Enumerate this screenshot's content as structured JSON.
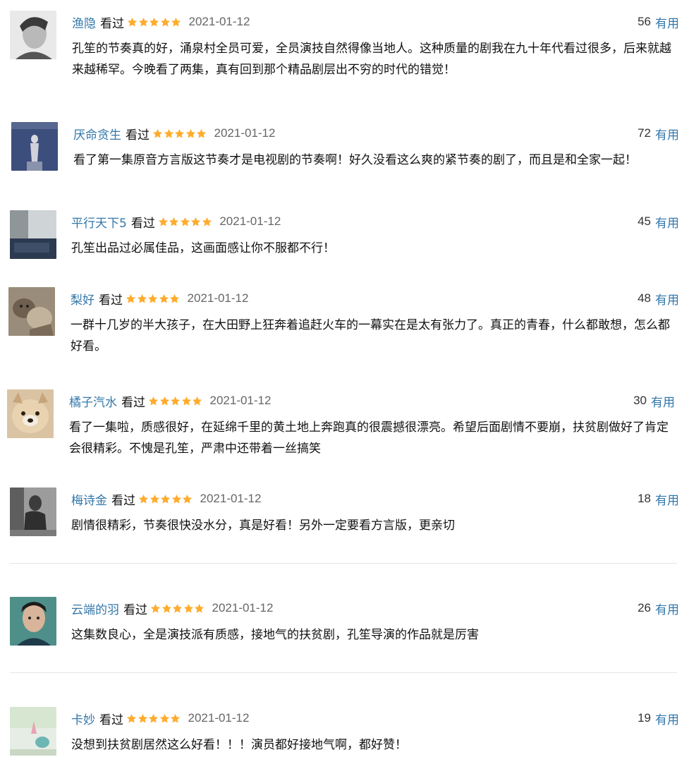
{
  "ui": {
    "watched_label": "看过",
    "vote_label": "有用"
  },
  "reviews": [
    {
      "user": "渔隐",
      "date": "2021-01-12",
      "votes": "56",
      "content": "孔笙的节奏真的好，涌泉村全员可爱，全员演技自然得像当地人。这种质量的剧我在九十年代看过很多，后来就越来越稀罕。今晚看了两集，真有回到那个精品剧层出不穷的时代的错觉！"
    },
    {
      "user": "厌命贪生",
      "date": "2021-01-12",
      "votes": "72",
      "content": "看了第一集原音方言版这节奏才是电视剧的节奏啊！好久没看这么爽的紧节奏的剧了，而且是和全家一起！"
    },
    {
      "user": "平行天下5",
      "date": "2021-01-12",
      "votes": "45",
      "content": "孔笙出品过必属佳品，这画面感让你不服都不行！"
    },
    {
      "user": "梨好",
      "date": "2021-01-12",
      "votes": "48",
      "content": "一群十几岁的半大孩子，在大田野上狂奔着追赶火车的一幕实在是太有张力了。真正的青春，什么都敢想，怎么都好看。"
    },
    {
      "user": "橘子汽水",
      "date": "2021-01-12",
      "votes": "30",
      "content": "看了一集啦，质感很好，在延绵千里的黄土地上奔跑真的很震撼很漂亮。希望后面剧情不要崩，扶贫剧做好了肯定会很精彩。不愧是孔笙，严肃中还带着一丝搞笑"
    },
    {
      "user": "梅诗金",
      "date": "2021-01-12",
      "votes": "18",
      "content": "剧情很精彩，节奏很快没水分，真是好看！另外一定要看方言版，更亲切"
    },
    {
      "user": "云端的羽",
      "date": "2021-01-12",
      "votes": "26",
      "content": "这集数良心，全是演技派有质感，接地气的扶贫剧，孔笙导演的作品就是厉害"
    },
    {
      "user": "卡妙",
      "date": "2021-01-12",
      "votes": "19",
      "content": "没想到扶贫剧居然这么好看！！！演员都好接地气啊，都好赞！"
    }
  ],
  "rating": {
    "stars": 5,
    "max": 5,
    "color": "#ffac2d"
  },
  "colors": {
    "link": "#3377aa",
    "date": "#666666",
    "divider": "#e6e6e6"
  }
}
